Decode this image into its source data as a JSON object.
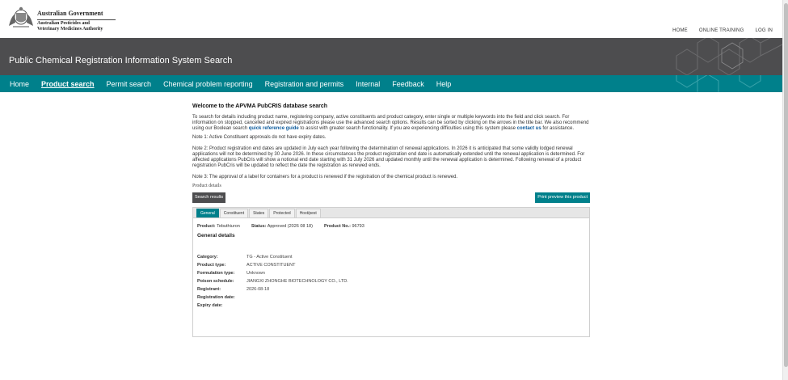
{
  "header": {
    "gov_name": "Australian Government",
    "authority_line1": "Australian Pesticides and",
    "authority_line2": "Veterinary Medicines Authority",
    "util_links": [
      "HOME",
      "ONLINE TRAINING",
      "LOG IN"
    ]
  },
  "title": "Public Chemical Registration Information System Search",
  "nav": {
    "items": [
      "Home",
      "Product search",
      "Permit search",
      "Chemical problem reporting",
      "Registration and permits",
      "Internal",
      "Feedback",
      "Help"
    ],
    "active": "Product search"
  },
  "content": {
    "welcome": "Welcome to the APVMA PubCRIS database search",
    "intro_pre": "To search for details including product name, registering company, active constituents and product category, enter single or multiple keywords into the field and click search. For information on stopped, cancelled and expired registrations please use the advanced search options. Results can be sorted by clicking on the arrows in the title bar. We also recommend using our Boolean search",
    "intro_link": "quick reference guide",
    "intro_mid": "to assist with greater search functionality. If you are experiencing difficulties using this system please",
    "contact_link": "contact us",
    "intro_post": "for assistance.",
    "note1": "Note 1: Active Constituent approvals do not have expiry dates.",
    "note2": "Note 2: Product registration end dates are updated in July each year following the determination of renewal applications. In 2026 it is anticipated that some validly lodged renewal applications will not be determined by 30 June 2026. In these circumstances the product registration end date is automatically extended until the renewal application is determined. For affected applications PubCris will show a notional end date starting with 31 July 2026 and updated monthly until the renewal application is determined. Following renewal of a product registration PubCris will be updated to reflect the date the registration as renewed ends.",
    "note3": "Note 3: The approval of a label for containers for a product is renewed if the registration of the chemical product is renewed.",
    "product_details_label": "Product details",
    "search_results_btn": "Search results",
    "print_btn": "Print preview this product",
    "tabs": [
      "General",
      "Constituent",
      "States",
      "Protected",
      "Host/pest"
    ],
    "active_tab": "General",
    "summary": {
      "product_label": "Product:",
      "product_value": "Tebuthiuron",
      "status_label": "Status:",
      "status_value": "Approved (2026 08 18)",
      "productno_label": "Product No.:",
      "productno_value": "96793"
    },
    "general_title": "General details",
    "details": [
      {
        "k": "Category:",
        "v": "TG - Active Constituent"
      },
      {
        "k": "Product type:",
        "v": "ACTIVE CONSTITUENT"
      },
      {
        "k": "Formulation type:",
        "v": "Unknown"
      },
      {
        "k": "Poison schedule:",
        "v": "JIANGXI ZHONGHE BIOTECHNOLOGY CO., LTD."
      },
      {
        "k": "Registrant:",
        "v": "2026-08-18"
      },
      {
        "k": "Registration date:",
        "v": ""
      },
      {
        "k": "Expiry date:",
        "v": ""
      }
    ]
  },
  "colors": {
    "teal": "#00808b",
    "charcoal": "#4d4d4f",
    "link": "#0b5a9c"
  }
}
